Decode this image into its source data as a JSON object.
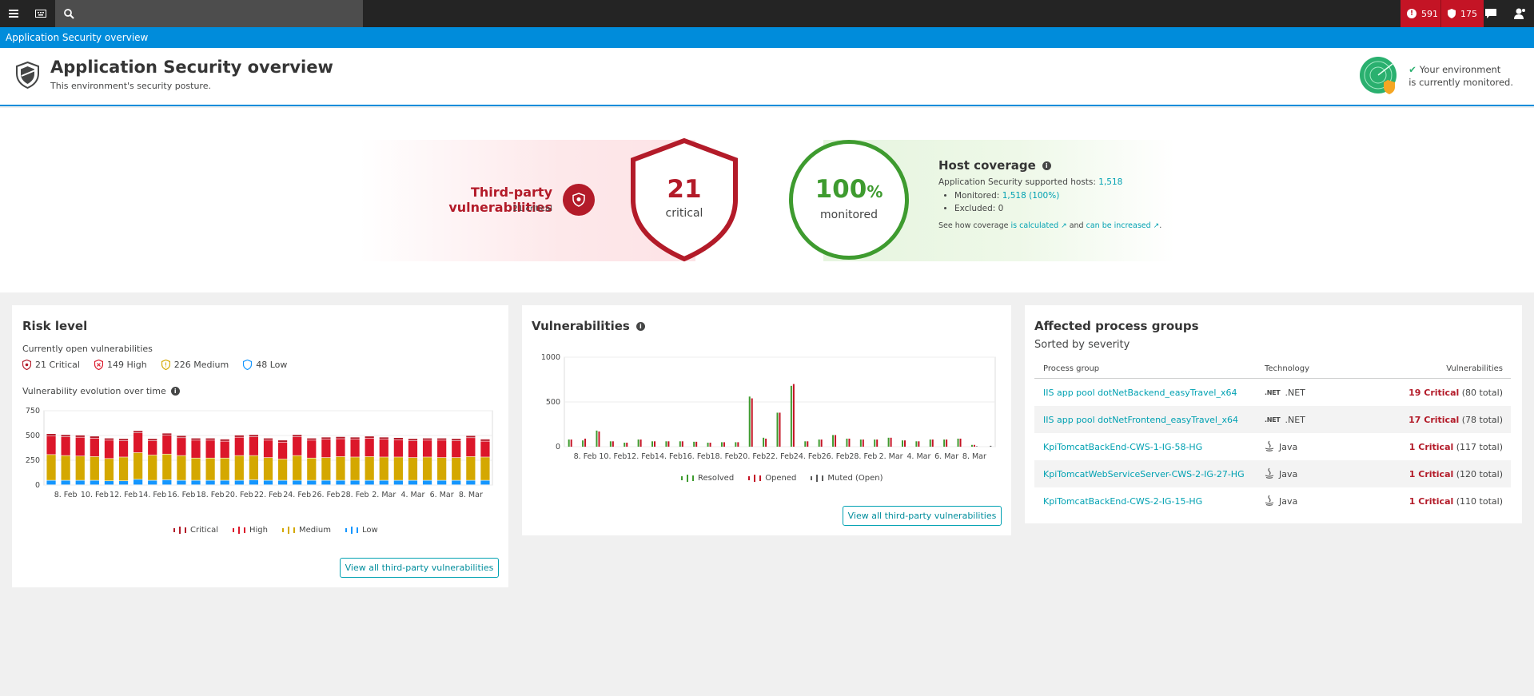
{
  "topbar": {
    "menu_icon": "hamburger-icon",
    "keyboard_icon": "keyboard-icon",
    "search_icon": "search-icon",
    "problems_count": "591",
    "security_count": "175",
    "chat_icon": "chat-icon",
    "user_icon": "user-icon"
  },
  "titlebar": {
    "text": "Application Security overview"
  },
  "header": {
    "title": "Application Security overview",
    "subtitle": "This environment's security posture.",
    "env_line1": "Your environment",
    "env_line2": "is currently monitored."
  },
  "hero": {
    "tpv_title": "Third-party vulnerabilities",
    "tpv_sub": "21 critical",
    "critical_count": "21",
    "critical_label": "critical",
    "monitored_value": "100",
    "monitored_unit": "%",
    "monitored_label": "monitored",
    "host_title": "Host coverage",
    "supported_label": "Application Security supported hosts:",
    "supported_value": "1,518",
    "monitored_item_label": "Monitored:",
    "monitored_item_value": "1,518 (100%)",
    "excluded_label": "Excluded: 0",
    "coverage_pre": "See how coverage",
    "coverage_link1": "is calculated",
    "coverage_and": "and",
    "coverage_link2": "can be increased",
    "coverage_end": "."
  },
  "risk": {
    "title": "Risk level",
    "open_label": "Currently open vulnerabilities",
    "critical": "21 Critical",
    "high": "149 High",
    "medium": "226 Medium",
    "low": "48 Low",
    "evolution_label": "Vulnerability evolution over time",
    "legend": [
      "Critical",
      "High",
      "Medium",
      "Low"
    ],
    "button": "View all third-party vulnerabilities"
  },
  "vulns": {
    "title": "Vulnerabilities",
    "legend": [
      "Resolved",
      "Opened",
      "Muted (Open)"
    ],
    "button": "View all third-party vulnerabilities"
  },
  "affected": {
    "title": "Affected process groups",
    "subtitle": "Sorted by severity",
    "columns": [
      "Process group",
      "Technology",
      "Vulnerabilities"
    ],
    "rows": [
      {
        "name": "IIS app pool dotNetBackend_easyTravel_x64",
        "tech_icon": ".NET",
        "tech": ".NET",
        "critical": "19 Critical",
        "total": "(80 total)"
      },
      {
        "name": "IIS app pool dotNetFrontend_easyTravel_x64",
        "tech_icon": ".NET",
        "tech": ".NET",
        "critical": "17 Critical",
        "total": "(78 total)"
      },
      {
        "name": "KpiTomcatBackEnd-CWS-1-IG-58-HG",
        "tech_icon": "java-icon",
        "tech": "Java",
        "critical": "1 Critical",
        "total": "(117 total)"
      },
      {
        "name": "KpiTomcatWebServiceServer-CWS-2-IG-27-HG",
        "tech_icon": "java-icon",
        "tech": "Java",
        "critical": "1 Critical",
        "total": "(120 total)"
      },
      {
        "name": "KpiTomcatBackEnd-CWS-2-IG-15-HG",
        "tech_icon": "java-icon",
        "tech": "Java",
        "critical": "1 Critical",
        "total": "(110 total)"
      }
    ]
  },
  "colors": {
    "critical": "#b31b29",
    "high": "#dc172a",
    "medium": "#d4a800",
    "low": "#1496ff",
    "resolved": "#3e9b2f",
    "opened": "#c41425",
    "muted": "#5a5a5a",
    "accent": "#008cdb",
    "link": "#00a1b2"
  },
  "chart_data": [
    {
      "type": "bar",
      "stacked": true,
      "x": [
        "7. Feb",
        "8. Feb",
        "9. Feb",
        "10. Feb",
        "11. Feb",
        "12. Feb",
        "13. Feb",
        "14. Feb",
        "15. Feb",
        "16. Feb",
        "17. Feb",
        "18. Feb",
        "19. Feb",
        "20. Feb",
        "21. Feb",
        "22. Feb",
        "23. Feb",
        "24. Feb",
        "25. Feb",
        "26. Feb",
        "27. Feb",
        "28. Feb",
        "1. Mar",
        "2. Mar",
        "3. Mar",
        "4. Mar",
        "5. Mar",
        "6. Mar",
        "7. Mar",
        "8. Mar",
        "9. Mar"
      ],
      "xticks": [
        "8. Feb",
        "10. Feb",
        "12. Feb",
        "14. Feb",
        "16. Feb",
        "18. Feb",
        "20. Feb",
        "22. Feb",
        "24. Feb",
        "26. Feb",
        "28. Feb",
        "2. Mar",
        "4. Mar",
        "6. Mar",
        "8. Mar"
      ],
      "yticks": [
        0,
        250,
        500,
        750
      ],
      "ylim": [
        0,
        750
      ],
      "series": [
        {
          "name": "Low",
          "values": [
            45,
            45,
            45,
            45,
            40,
            40,
            55,
            45,
            50,
            45,
            45,
            45,
            45,
            45,
            50,
            45,
            45,
            45,
            45,
            45,
            45,
            45,
            45,
            45,
            45,
            45,
            45,
            45,
            45,
            45,
            45
          ]
        },
        {
          "name": "Medium",
          "values": [
            260,
            250,
            245,
            240,
            225,
            240,
            270,
            255,
            260,
            250,
            225,
            225,
            225,
            250,
            245,
            230,
            215,
            250,
            225,
            230,
            240,
            235,
            240,
            235,
            235,
            230,
            235,
            230,
            230,
            240,
            235
          ]
        },
        {
          "name": "High",
          "values": [
            190,
            190,
            190,
            185,
            185,
            165,
            200,
            145,
            190,
            180,
            180,
            180,
            170,
            185,
            190,
            175,
            170,
            190,
            180,
            185,
            180,
            180,
            185,
            180,
            175,
            170,
            170,
            175,
            170,
            190,
            160
          ]
        },
        {
          "name": "Critical",
          "values": [
            21,
            21,
            21,
            21,
            21,
            21,
            21,
            21,
            21,
            21,
            21,
            21,
            21,
            21,
            21,
            21,
            21,
            21,
            21,
            21,
            21,
            21,
            21,
            21,
            21,
            21,
            21,
            21,
            21,
            21,
            21
          ]
        }
      ]
    },
    {
      "type": "bar",
      "x": [
        "7. Feb",
        "8. Feb",
        "9. Feb",
        "10. Feb",
        "11. Feb",
        "12. Feb",
        "13. Feb",
        "14. Feb",
        "15. Feb",
        "16. Feb",
        "17. Feb",
        "18. Feb",
        "19. Feb",
        "20. Feb",
        "21. Feb",
        "22. Feb",
        "23. Feb",
        "24. Feb",
        "25. Feb",
        "26. Feb",
        "27. Feb",
        "28. Feb",
        "1. Mar",
        "2. Mar",
        "3. Mar",
        "4. Mar",
        "5. Mar",
        "6. Mar",
        "7. Mar",
        "8. Mar",
        "9. Mar"
      ],
      "xticks": [
        "8. Feb",
        "10. Feb",
        "12. Feb",
        "14. Feb",
        "16. Feb",
        "18. Feb",
        "20. Feb",
        "22. Feb",
        "24. Feb",
        "26. Feb",
        "28. Feb",
        "2. Mar",
        "4. Mar",
        "6. Mar",
        "8. Mar"
      ],
      "yticks": [
        0,
        500,
        1000
      ],
      "ylim": [
        0,
        1000
      ],
      "series": [
        {
          "name": "Resolved",
          "values": [
            80,
            70,
            180,
            60,
            45,
            80,
            60,
            60,
            60,
            55,
            45,
            50,
            50,
            560,
            100,
            380,
            680,
            60,
            80,
            130,
            90,
            80,
            80,
            100,
            70,
            60,
            80,
            80,
            90,
            20,
            0
          ]
        },
        {
          "name": "Opened",
          "values": [
            80,
            90,
            170,
            60,
            45,
            80,
            60,
            60,
            60,
            55,
            45,
            50,
            50,
            540,
            90,
            380,
            700,
            60,
            80,
            130,
            90,
            80,
            80,
            100,
            70,
            60,
            80,
            80,
            90,
            20,
            0
          ]
        },
        {
          "name": "Muted (Open)",
          "values": [
            0,
            0,
            0,
            0,
            0,
            0,
            0,
            0,
            0,
            0,
            0,
            0,
            0,
            0,
            0,
            0,
            0,
            0,
            0,
            0,
            0,
            0,
            0,
            0,
            0,
            0,
            0,
            0,
            0,
            5,
            10
          ]
        }
      ]
    }
  ]
}
